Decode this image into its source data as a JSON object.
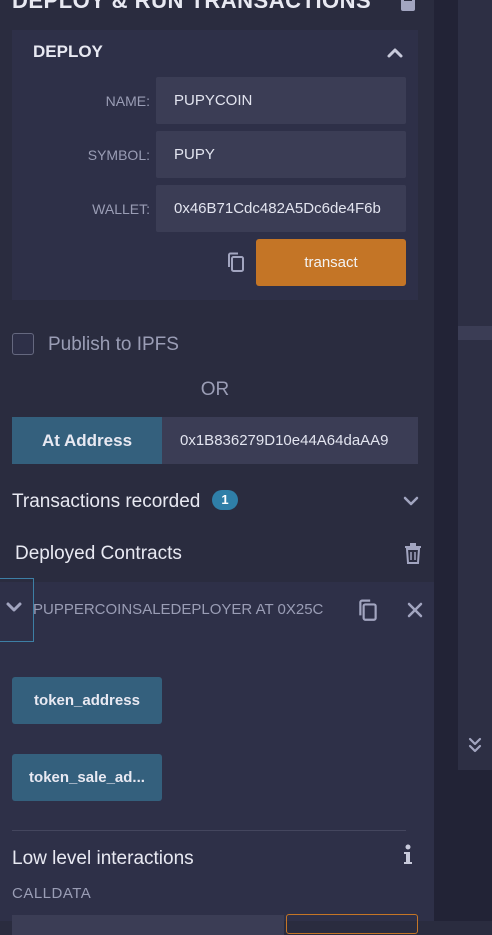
{
  "header": {
    "title": "DEPLOY & RUN TRANSACTIONS"
  },
  "deploy": {
    "section_label": "DEPLOY",
    "fields": [
      {
        "label": "NAME:",
        "value": "PUPYCOIN"
      },
      {
        "label": "SYMBOL:",
        "value": "PUPY"
      },
      {
        "label": "WALLET:",
        "value": "0x46B71Cdc482A5Dc6de4F6b"
      }
    ],
    "transact_label": "transact"
  },
  "publish": {
    "label": "Publish to IPFS",
    "checked": false
  },
  "or_label": "OR",
  "at_address": {
    "button_label": "At Address",
    "value": "0x1B836279D10e44A64daAA9"
  },
  "transactions": {
    "label": "Transactions recorded",
    "count": "1"
  },
  "deployed": {
    "label": "Deployed Contracts",
    "contract": {
      "title": "PUPPERCOINSALEDEPLOYER AT 0X25C",
      "functions": [
        "token_address",
        "token_sale_ad..."
      ]
    }
  },
  "low_level": {
    "label": "Low level interactions",
    "calldata_label": "CALLDATA"
  },
  "colors": {
    "background": "#2a2c3f",
    "accent_orange": "#c47526",
    "button_blue": "#34607d",
    "badge_blue": "#2f7fa8"
  },
  "icons": [
    "book-icon",
    "chevron-up-icon",
    "copy-icon",
    "chevron-down-icon",
    "trash-icon",
    "close-icon",
    "info-icon",
    "double-chevron-down-icon"
  ]
}
